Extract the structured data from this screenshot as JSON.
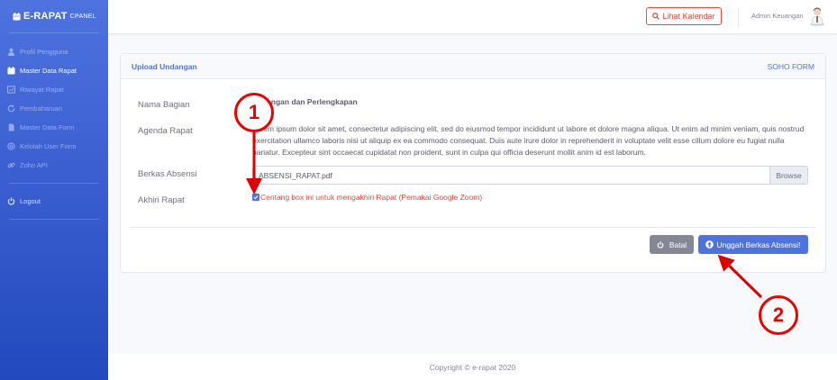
{
  "sidebar": {
    "brand": "E-RAPAT",
    "brand_sub": "CPANEL",
    "items": [
      {
        "label": "Profil Pengguna",
        "active": false
      },
      {
        "label": "Master Data Rapat",
        "active": true
      },
      {
        "label": "Riwayat Rapat",
        "active": false
      },
      {
        "label": "Pembaharuan",
        "active": false
      },
      {
        "label": "Master Data Form",
        "active": false
      },
      {
        "label": "Kelolah User Form",
        "active": false
      },
      {
        "label": "Zoho API",
        "active": false
      }
    ],
    "logout": "Logout"
  },
  "topbar": {
    "calendar_button": "Lihat Kalendar",
    "user_name": "Admin Keuangan"
  },
  "card": {
    "title": "Upload Undangan",
    "right_label": "SOHO FORM"
  },
  "form": {
    "nama_bagian_label": "Nama Bagian",
    "nama_bagian_value": "Keuangan dan Perlengkapan",
    "agenda_label": "Agenda Rapat",
    "agenda_value": "Lorem ipsum dolor sit amet, consectetur adipiscing elit, sed do eiusmod tempor incididunt ut labore et dolore magna aliqua. Ut enim ad minim veniam, quis nostrud exercitation ullamco laboris nisi ut aliquip ex ea commodo consequat. Duis aute irure dolor in reprehenderit in voluptate velit esse cillum dolore eu fugiat nulla pariatur. Excepteur sint occaecat cupidatat non proident, sunt in culpa qui officia deserunt mollit anim id est laborum.",
    "berkas_label": "Berkas Absensi",
    "berkas_value": "ABSENSI_RAPAT.pdf",
    "browse_label": "Browse",
    "akhiri_label": "Akhiri Rapat",
    "checkbox_checked": true,
    "checkbox_label": "Centang box ini untuk mengakhiri Rapat (Pemakai Google Zoom)"
  },
  "actions": {
    "cancel": "Batal",
    "upload": "Unggah Berkas Absensi!"
  },
  "footer": {
    "copyright": "Copyright © e-rapat 2020"
  },
  "annotations": {
    "marker1": "1",
    "marker2": "2"
  },
  "colors": {
    "primary": "#4e73df",
    "danger": "#e74a3b",
    "secondary": "#858796",
    "annotation": "#e00000"
  }
}
